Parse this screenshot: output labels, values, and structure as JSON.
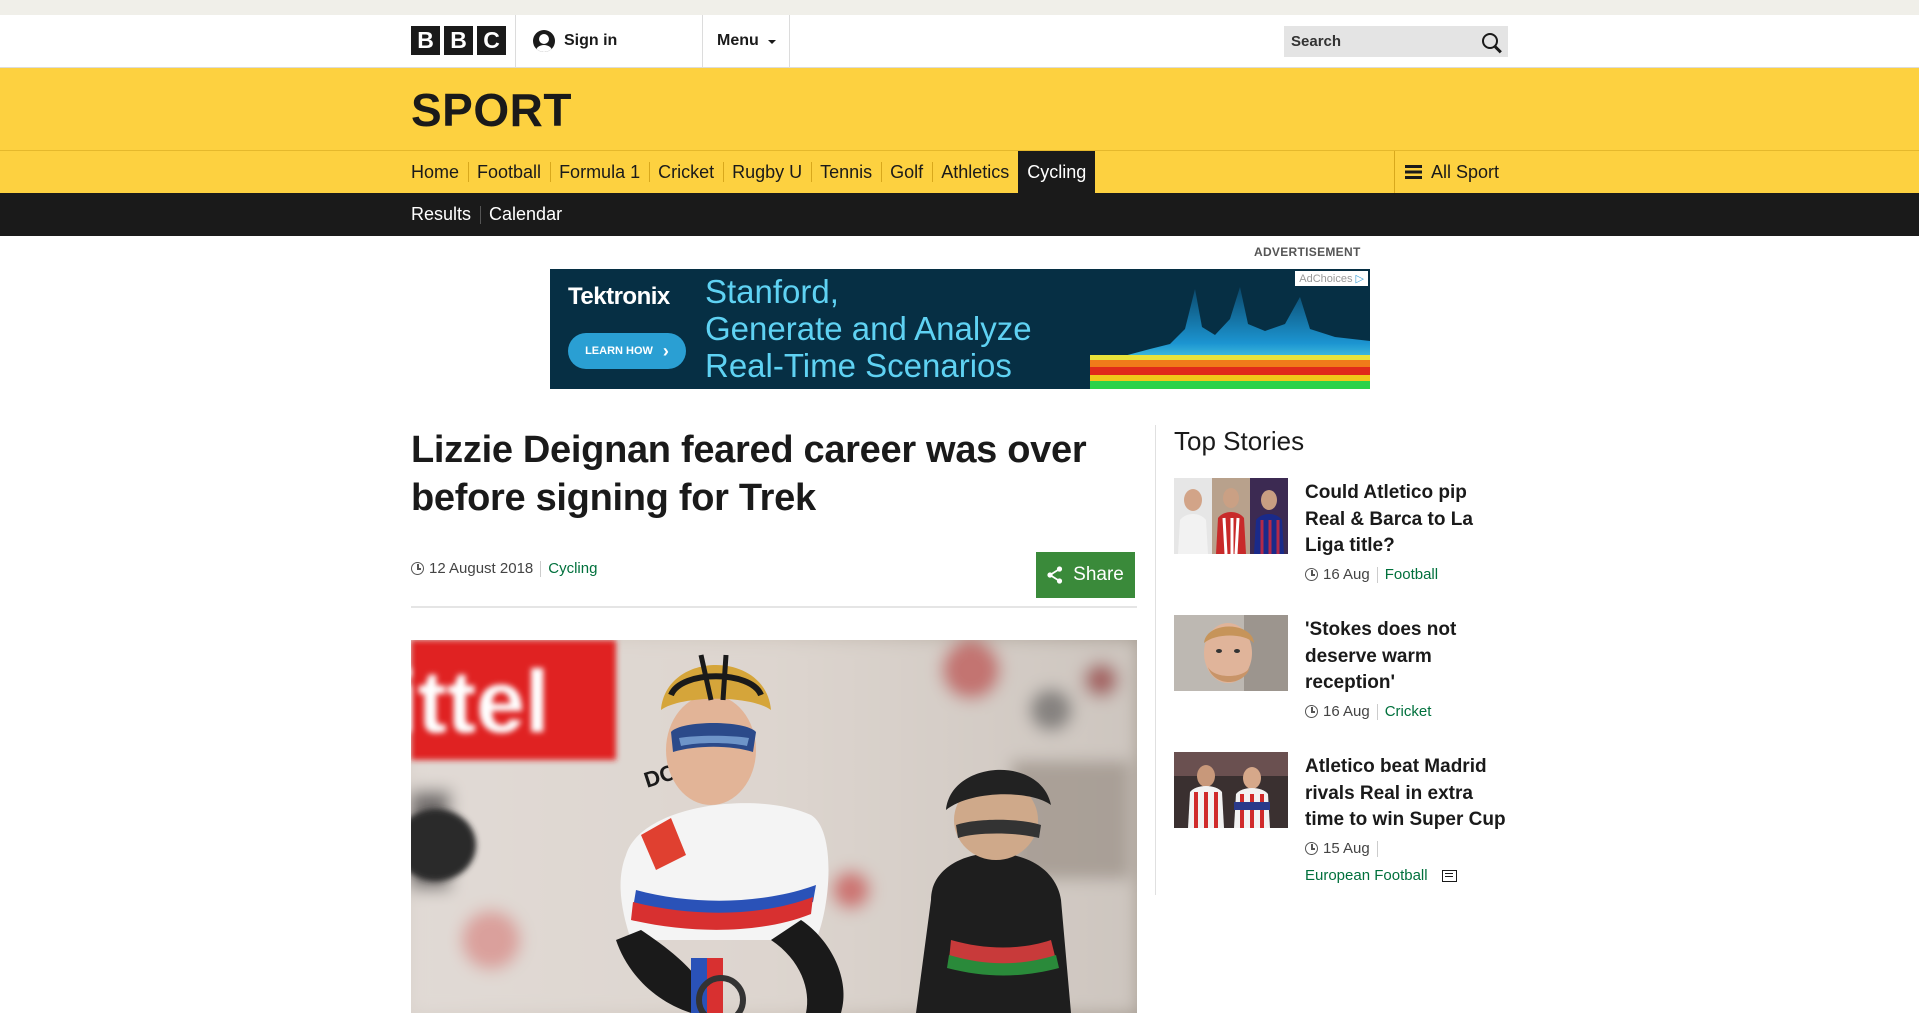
{
  "header": {
    "logo_letters": [
      "B",
      "B",
      "C"
    ],
    "signin_label": "Sign in",
    "menu_label": "Menu",
    "search_placeholder": "Search"
  },
  "sport": {
    "title": "SPORT",
    "nav": [
      "Home",
      "Football",
      "Formula 1",
      "Cricket",
      "Rugby U",
      "Tennis",
      "Golf",
      "Athletics",
      "Cycling"
    ],
    "active_nav": "Cycling",
    "all_sport_label": "All Sport",
    "subnav": [
      "Results",
      "Calendar"
    ]
  },
  "ad": {
    "label": "ADVERTISEMENT",
    "brand": "Tektronix",
    "button_label": "LEARN HOW",
    "lines": [
      "Stanford,",
      "Generate and Analyze",
      "Real-Time Scenarios"
    ],
    "adchoices": "AdChoices"
  },
  "article": {
    "headline": "Lizzie Deignan feared career was over before signing for Trek",
    "date": "12 August 2018",
    "topic": "Cycling",
    "share_label": "Share",
    "image_text": "ittel"
  },
  "top_stories": {
    "title": "Top Stories",
    "items": [
      {
        "title": "Could Atletico pip Real & Barca to La Liga title?",
        "time": "16 Aug",
        "topic": "Football"
      },
      {
        "title": "'Stokes does not deserve warm reception'",
        "time": "16 Aug",
        "topic": "Cricket"
      },
      {
        "title": "Atletico beat Madrid rivals Real in extra time to win Super Cup",
        "time": "15 Aug",
        "topic": "European Football"
      }
    ]
  },
  "colors": {
    "sport_yellow": "#fdd140",
    "nav_black": "#1a1a1a",
    "link_green": "#00703c",
    "share_green": "#3a8a3a"
  }
}
